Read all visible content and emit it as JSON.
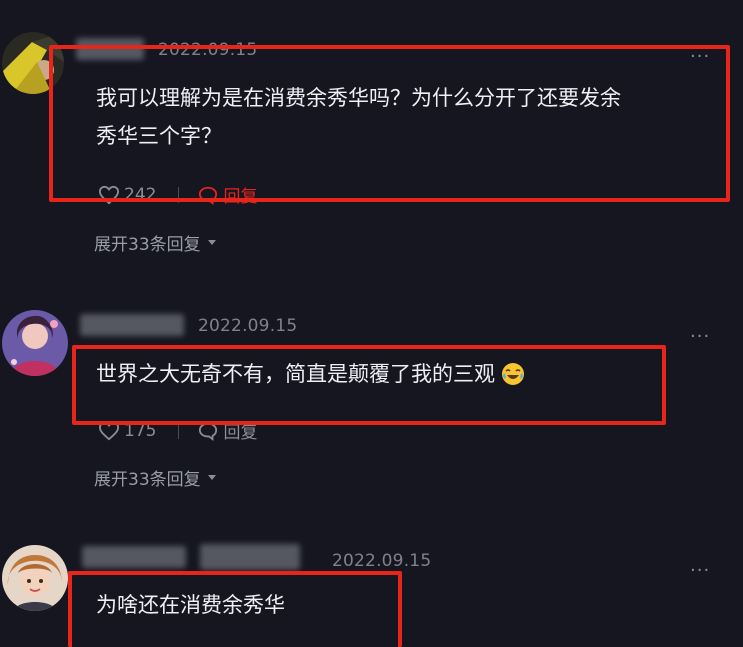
{
  "comments": [
    {
      "date": "2022.09.15",
      "text": "我可以理解为是在消费余秀华吗？为什么分开了还要发余秀华三个字？",
      "line1": "我可以理解为是在消费余秀华吗？为什么分开了还要发余",
      "line2": "秀华三个字？",
      "likes": "242",
      "reply_label": "回复",
      "expand_label": "展开33条回复"
    },
    {
      "date": "2022.09.15",
      "text": "世界之大无奇不有，简直是颠覆了我的三观",
      "likes": "175",
      "reply_label": "回复",
      "expand_label": "展开33条回复"
    },
    {
      "date": "2022.09.15",
      "text": "为啥还在消费余秀华"
    }
  ],
  "colors": {
    "highlight": "#e8251b",
    "background": "#15161f"
  },
  "icons": [
    "heart-icon",
    "reply-icon",
    "more-icon",
    "chevron-down-icon",
    "laughing-crying-emoji"
  ]
}
